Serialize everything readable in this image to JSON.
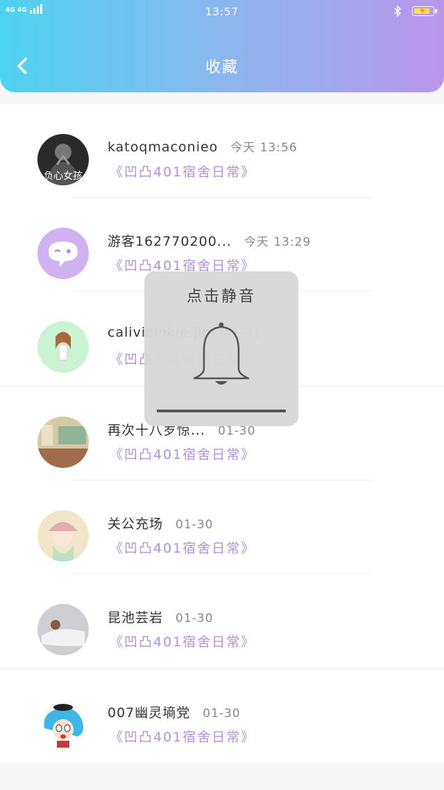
{
  "status_bar": {
    "network_label": "4G 4G",
    "time": "13:57",
    "bluetooth_icon": "bluetooth-icon",
    "battery_icon": "battery-charging-icon"
  },
  "header": {
    "title": "收藏",
    "back_icon": "back-arrow-icon",
    "gradient": [
      "#4dd3f2",
      "#b996ec"
    ]
  },
  "accent_color": "#b48fe0",
  "favorites": [
    {
      "name": "katoqmaconieo",
      "time": "今天 13:56",
      "subtitle": "《凹凸401宿舍日常》",
      "avatar_text": "负心女孩"
    },
    {
      "name": "游客162770200...",
      "time": "今天 13:29",
      "subtitle": "《凹凸401宿舍日常》"
    },
    {
      "name": "calivicinkle.jin",
      "time": "01-31",
      "subtitle": "《凹凸401宿舍日常》"
    },
    {
      "name": "再次十八岁惊...",
      "time": "01-30",
      "subtitle": "《凹凸401宿舍日常》"
    },
    {
      "name": "关公充场",
      "time": "01-30",
      "subtitle": "《凹凸401宿舍日常》"
    },
    {
      "name": "昆池芸岩",
      "time": "01-30",
      "subtitle": "《凹凸401宿舍日常》"
    },
    {
      "name": "007幽灵墒党",
      "time": "01-30",
      "subtitle": "《凹凸401宿舍日常》"
    }
  ],
  "mute_toast": {
    "label": "点击静音",
    "icon": "bell-icon"
  }
}
